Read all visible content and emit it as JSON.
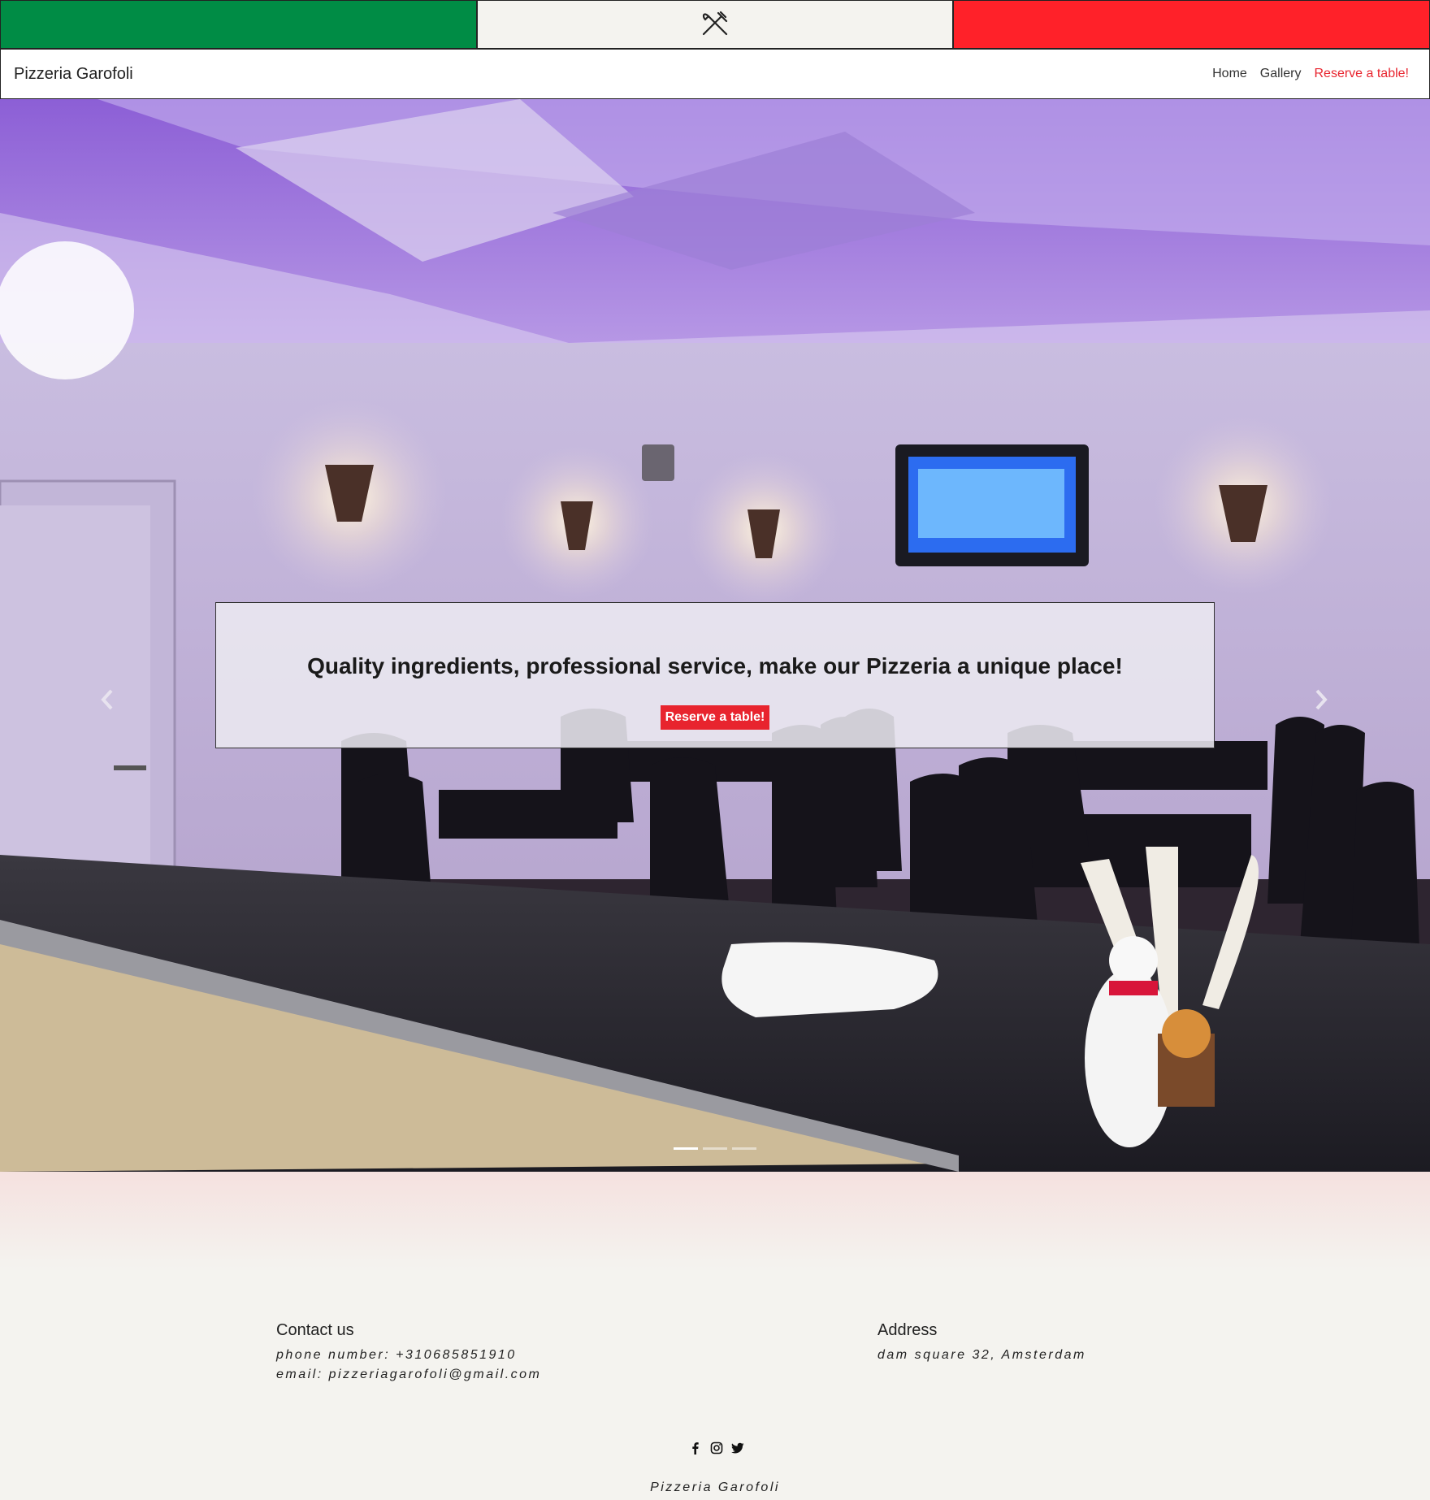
{
  "colors": {
    "green": "#008c45",
    "white": "#f4f3ef",
    "red": "#ff2129",
    "accent": "#e8242e"
  },
  "flag": {
    "icon": "fork-knife-icon"
  },
  "navbar": {
    "brand": "Pizzeria Garofoli",
    "links": [
      {
        "label": "Home"
      },
      {
        "label": "Gallery"
      },
      {
        "label": "Reserve a table!"
      }
    ]
  },
  "hero": {
    "caption": "Quality ingredients, professional service, make our Pizzeria a unique place!",
    "button": "Reserve a table!",
    "prev_icon": "chevron-left-icon",
    "next_icon": "chevron-right-icon",
    "active_slide": 1,
    "slides_count": 3
  },
  "footer": {
    "contact": {
      "heading": "Contact us",
      "phone": "phone number: +310685851910",
      "email": "email: pizzeriagarofoli@gmail.com"
    },
    "address": {
      "heading": "Address",
      "line": "dam square 32, Amsterdam"
    },
    "social": [
      "facebook-icon",
      "instagram-icon",
      "twitter-icon"
    ],
    "copyright": "Pizzeria Garofoli"
  }
}
